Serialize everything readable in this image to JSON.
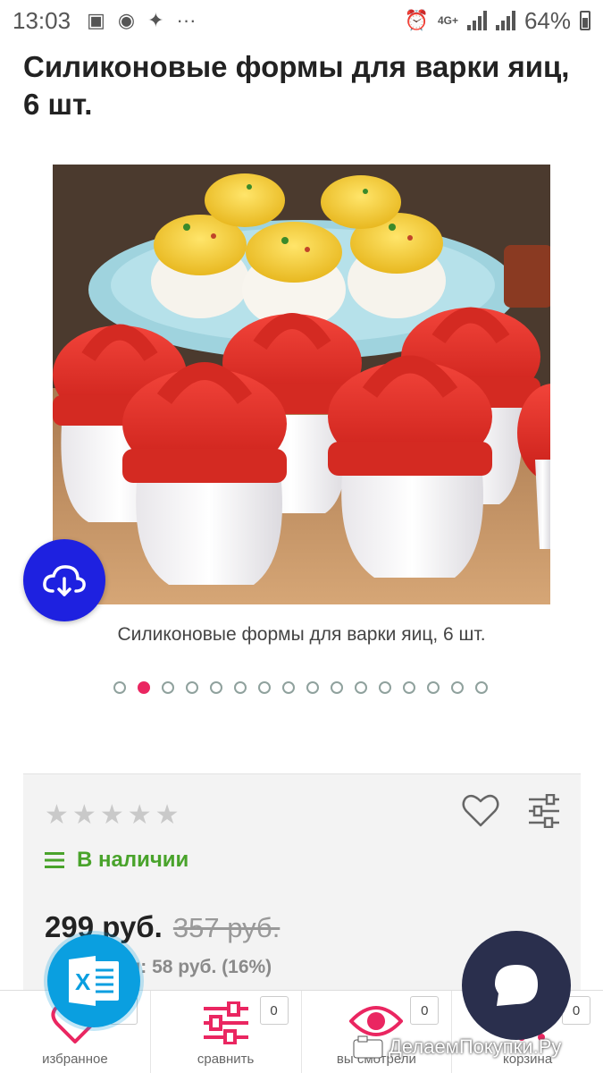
{
  "status_bar": {
    "time": "13:03",
    "network": "4G+",
    "battery": "64%",
    "icons": [
      "image-icon",
      "sberbank-icon",
      "sparkle-icon",
      "more-icon",
      "alarm-icon",
      "signal-icon",
      "battery-icon"
    ]
  },
  "product": {
    "title": "Силиконовые формы для варки яиц, 6 шт.",
    "caption": "Силиконовые формы для варки яиц, 6 шт.",
    "slide_count": 16,
    "active_slide": 2,
    "rating": 0,
    "rating_max": 5,
    "availability": "В наличии",
    "price": "299 руб.",
    "old_price": "357 руб.",
    "saving_visible": "я: 58 руб. (16%)"
  },
  "colors": {
    "accent_pink": "#ea2661",
    "in_stock_green": "#49a32b",
    "download_blue": "#1e21e0",
    "excel_blue": "#0a9fe0",
    "chat_navy": "#2a2f4d"
  },
  "bottom_nav": [
    {
      "label": "избранное",
      "count": "0",
      "icon": "heart-icon"
    },
    {
      "label": "сравнить",
      "count": "0",
      "icon": "sliders-icon"
    },
    {
      "label": "вы смотрели",
      "count": "0",
      "icon": "eye-icon"
    },
    {
      "label": "корзина",
      "count": "0",
      "icon": "cart-icon"
    }
  ],
  "watermark": "ДелаемПокупки.Ру"
}
